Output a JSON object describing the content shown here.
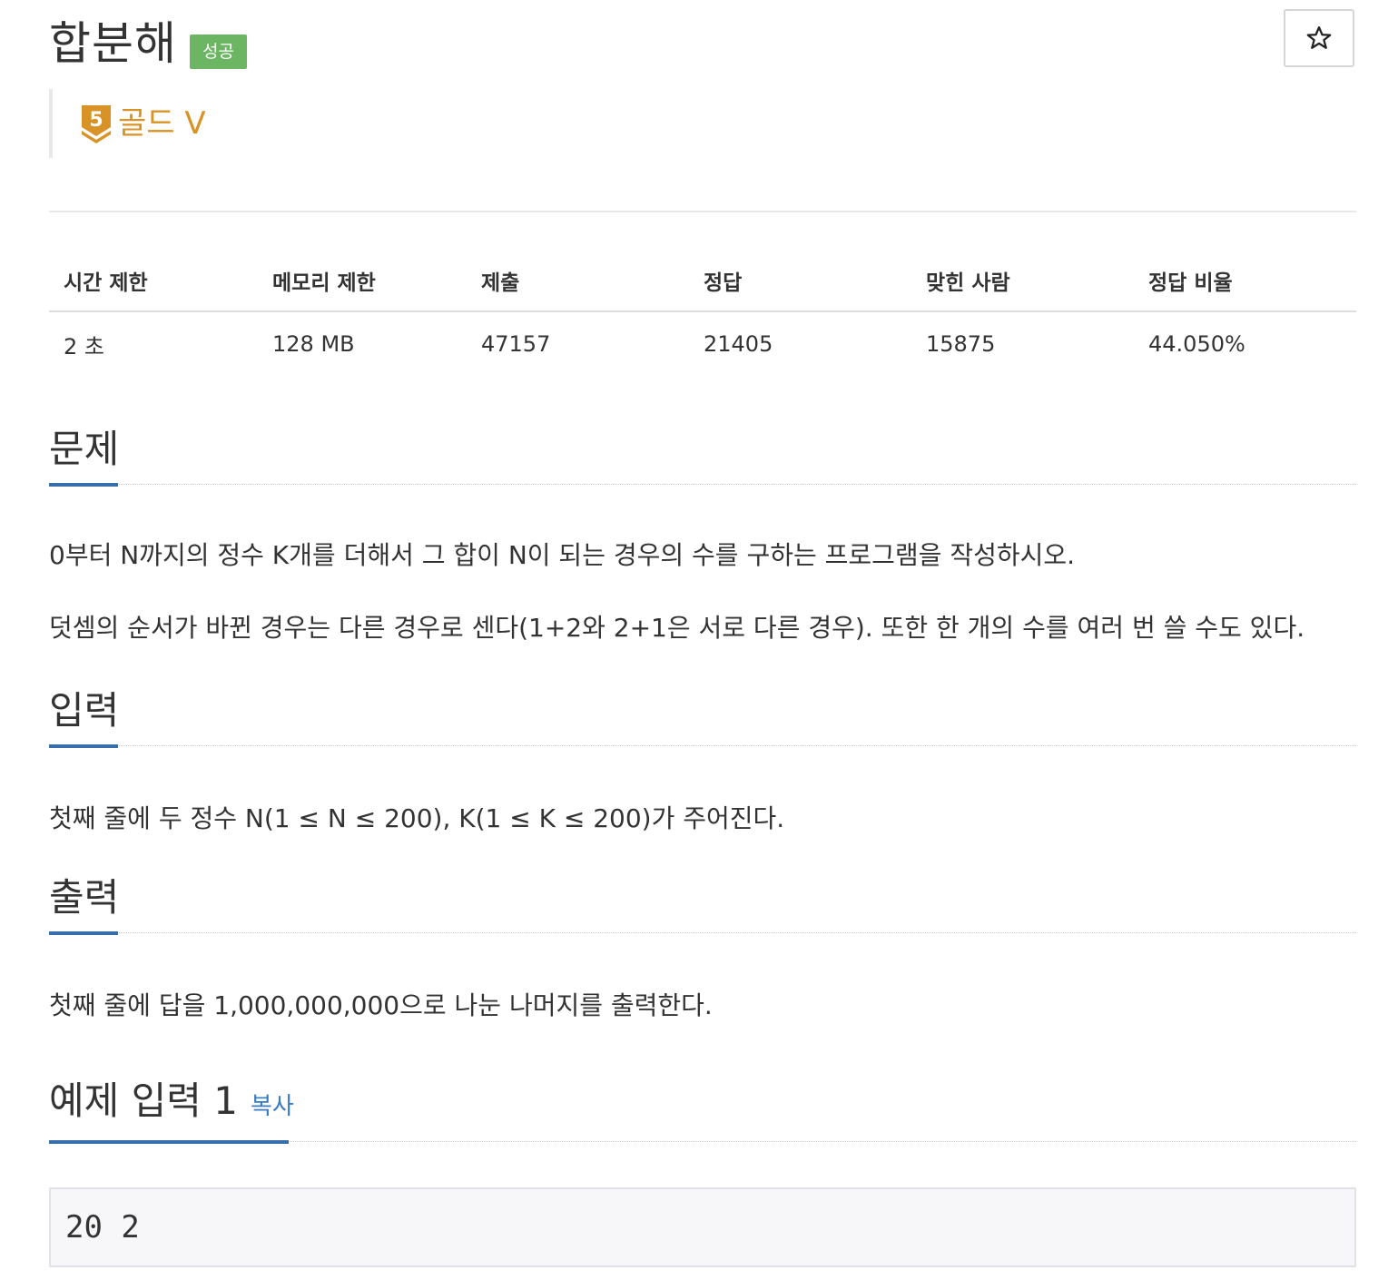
{
  "problem": {
    "title": "합분해",
    "status": "성공",
    "tier_number": "5",
    "tier_label": "골드 V"
  },
  "colors": {
    "status_badge": "#6cb563",
    "tier": "#d99226",
    "section_underline": "#376fad",
    "link": "#3a7cc3"
  },
  "icons": {
    "star": "star-outline-icon",
    "tier": "gold-tier-shield-icon"
  },
  "info_table": {
    "headers": [
      "시간 제한",
      "메모리 제한",
      "제출",
      "정답",
      "맞힌 사람",
      "정답 비율"
    ],
    "row": [
      "2 초",
      "128 MB",
      "47157",
      "21405",
      "15875",
      "44.050%"
    ]
  },
  "sections": {
    "description": {
      "title": "문제",
      "paragraphs": [
        "0부터 N까지의 정수 K개를 더해서 그 합이 N이 되는 경우의 수를 구하는 프로그램을 작성하시오.",
        "덧셈의 순서가 바뀐 경우는 다른 경우로 센다(1+2와 2+1은 서로 다른 경우). 또한 한 개의 수를 여러 번 쓸 수도 있다."
      ]
    },
    "input": {
      "title": "입력",
      "text": "첫째 줄에 두 정수 N(1 ≤ N ≤ 200), K(1 ≤ K ≤ 200)가 주어진다."
    },
    "output": {
      "title": "출력",
      "text": "첫째 줄에 답을 1,000,000,000으로 나눈 나머지를 출력한다."
    },
    "sample_input_1": {
      "title": "예제 입력 1",
      "copy_label": "복사",
      "content": "20 2"
    }
  }
}
